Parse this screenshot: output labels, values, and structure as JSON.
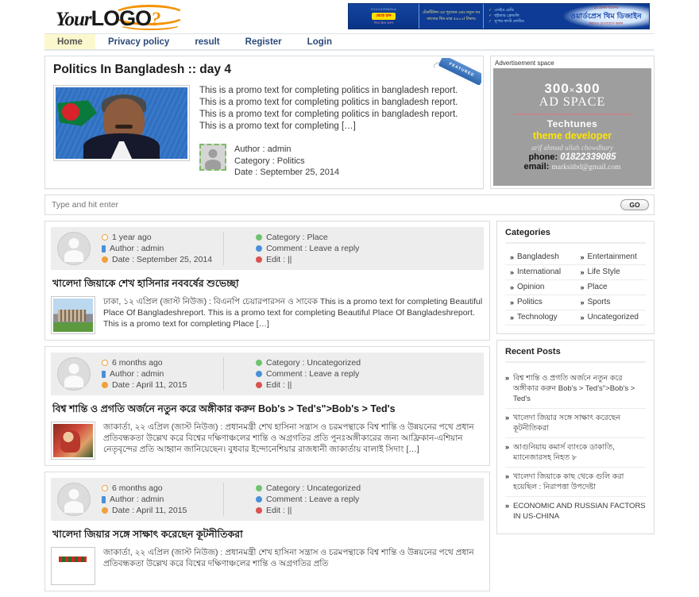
{
  "site": {
    "logo_main": "Your",
    "logo_bold": "LOGO",
    "logo_q": "?"
  },
  "banner": {
    "phone": "০১৮২২৩৩৯০৮৫",
    "button": "যেতে চান",
    "sub": "নিচে ক্লিক করুন",
    "col2": "টেকটিউন্স এর পুরাতন এবং নতুন সব কাজের থিম মাত্র ৫৯০০/ টাকায়",
    "items": [
      "এসইও রেডি",
      "হুইজার ফ্রেন্ডলি",
      "সুপার ফাস্ট লোডিং"
    ],
    "right_top": "যে কোন ধরনের",
    "right_main": "ওয়ার্ডপ্রেস থিম ডিজাইন",
    "right_sub": "করাতে যোগাযোগ করুন"
  },
  "nav": {
    "items": [
      {
        "label": "Home",
        "active": true
      },
      {
        "label": "Privacy policy",
        "active": false
      },
      {
        "label": "result",
        "active": false
      },
      {
        "label": "Register",
        "active": false
      },
      {
        "label": "Login",
        "active": false
      }
    ]
  },
  "feature": {
    "badge": "FEATURED",
    "title": "Politics In Bangladesh :: day 4",
    "promo": "This is a promo text for completing politics in bangladesh report. This is a promo text for completing politics in bangladesh report. This is a promo text for completing politics in bangladesh report. This is a promo text for completing […]",
    "author": "Author : admin",
    "category": "Category : Politics",
    "date": "Date : September 25, 2014"
  },
  "ad": {
    "label": "Advertisement space",
    "size_num": "300",
    "size_x": "×",
    "size_num2": "300",
    "space": "AD SPACE",
    "brand": "Techtunes",
    "tagline": "theme developer",
    "person": "arif ahmad ullah chowdhury",
    "phone_label": "phone:",
    "phone": "01822339085",
    "email_label": "email:",
    "email": "marksitbd@gmail.com"
  },
  "search": {
    "placeholder": "Type and hit enter",
    "value": "",
    "go": "GO"
  },
  "posts": [
    {
      "ago": "1 year ago",
      "author": "Author : admin",
      "date": "Date : September 25, 2014",
      "category": "Category : Place",
      "comment": "Comment : Leave a reply",
      "edit": "Edit : ||",
      "title": "খালেদা জিয়াকে শেখ হাসিনার নববর্ষের শুভেচ্ছা",
      "excerpt": "ঢাকা, ১২ এপ্রিল (জাস্ট নিউজ) : বিএনপি চেয়ারপারসন ও সাবেক  This is a promo text for completing Beautiful Place Of Bangladeshreport. This is a promo text for completing Beautiful Place Of Bangladeshreport. This is a promo text for completing  Place […]",
      "thumb": "bldg"
    },
    {
      "ago": "6 months ago",
      "author": "Author : admin",
      "date": "Date : April 11, 2015",
      "category": "Category : Uncategorized",
      "comment": "Comment : Leave a reply",
      "edit": "Edit : ||",
      "title": "বিশ্ব শান্তি ও প্রগতি অর্জনে নতুন করে অঙ্গীকার করুন Bob's > Ted's\">Bob's > Ted's",
      "excerpt": "জাকার্তা, ২২ এপ্রিল (জাস্ট নিউজ) : প্রধানমন্ত্রী শেখ হাসিনা সন্ত্রাস ও চরমপন্থাকে বিশ্ব শান্তি ও উন্নয়নের পথে প্রধান প্রতিবন্ধকতা উল্লেখ করে বিশ্বের দক্ষিণাঞ্চলের শান্তি ও অগ্রগতির প্রতি পুনঃঅঙ্গীকারের জন্য আফ্রিকান-এশিয়ান নেতৃবৃন্দের প্রতি আহ্বান জানিয়েছেন।  বুধবার ইন্দোনেশিয়ার রাজধানী জাকার্তায় বালাই সিদাং […]",
      "thumb": "dance"
    },
    {
      "ago": "6 months ago",
      "author": "Author : admin",
      "date": "Date : April 11, 2015",
      "category": "Category : Uncategorized",
      "comment": "Comment : Leave a reply",
      "edit": "Edit : ||",
      "title": "খালেদা জিয়ার সঙ্গে সাক্ষাৎ করেছেন কূটনীতিকরা",
      "excerpt": "জাকার্তা, ২২ এপ্রিল (জাস্ট নিউজ) : প্রধানমন্ত্রী শেখ হাসিনা সন্ত্রাস ও চরমপন্থাকে বিশ্ব শান্তি ও উন্নয়নের পথে প্রধান প্রতিবন্ধকতা উল্লেখ করে বিশ্বের দক্ষিণাঞ্চলের শান্তি ও অগ্রগতির প্রতি",
      "thumb": "news"
    }
  ],
  "sidebar": {
    "categories_title": "Categories",
    "categories": [
      "Bangladesh",
      "Entertainment",
      "International",
      "Life Style",
      "Opinion",
      "Place",
      "Politics",
      "Sports",
      "Technology",
      "Uncategorized"
    ],
    "recent_title": "Recent Posts",
    "recent": [
      "বিশ্ব শান্তি ও প্রগতি অর্জনে নতুন করে অঙ্গীকার করুন Bob's > Ted's\">Bob's > Ted's",
      "খালেদা জিয়ার সঙ্গে সাক্ষাৎ করেছেন কূটনীতিকরা",
      "আগুনিয়ায় কমার্স ব্যাংকে ডাকাতি, ম্যানেজারসহ নিহত ৮",
      "খালেদা জিয়াকে কাছ থেকে গুলি করা হয়েছিল : নিরাপত্তা উপদেষ্টা",
      "ECONOMIC AND RUSSIAN FACTORS IN US-CHINA"
    ]
  }
}
